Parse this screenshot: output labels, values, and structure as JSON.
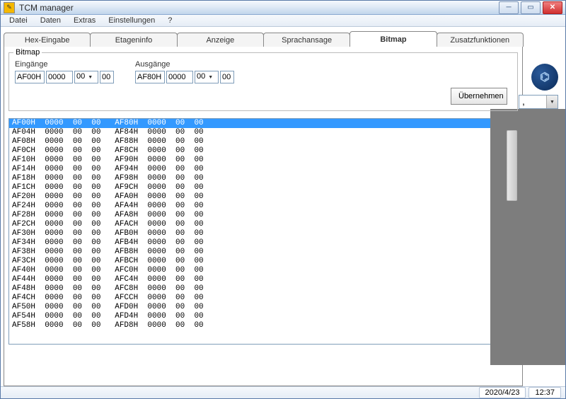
{
  "window": {
    "title": "TCM manager"
  },
  "menu": {
    "items": [
      "Datei",
      "Daten",
      "Extras",
      "Einstellungen",
      "?"
    ]
  },
  "tabs": {
    "items": [
      "Hex-Eingabe",
      "Etageninfo",
      "Anzeige",
      "Sprachansage",
      "Bitmap",
      "Zusatzfunktionen"
    ],
    "active": 4
  },
  "sidebar_dropdown": {
    "value": ","
  },
  "bitmap_group": {
    "legend": "Bitmap",
    "inputs_label": "Eingänge",
    "outputs_label": "Ausgänge",
    "apply_label": "Übernehmen",
    "in": {
      "addr": "AF00H",
      "word": "0000",
      "sel": "00",
      "byte": "00"
    },
    "out": {
      "addr": "AF80H",
      "word": "0000",
      "sel": "00",
      "byte": "00"
    }
  },
  "data_list": {
    "selected": 0,
    "rows": [
      [
        "AF00H",
        "0000",
        "00",
        "00",
        "AF80H",
        "0000",
        "00",
        "00"
      ],
      [
        "AF04H",
        "0000",
        "00",
        "00",
        "AF84H",
        "0000",
        "00",
        "00"
      ],
      [
        "AF08H",
        "0000",
        "00",
        "00",
        "AF88H",
        "0000",
        "00",
        "00"
      ],
      [
        "AF0CH",
        "0000",
        "00",
        "00",
        "AF8CH",
        "0000",
        "00",
        "00"
      ],
      [
        "AF10H",
        "0000",
        "00",
        "00",
        "AF90H",
        "0000",
        "00",
        "00"
      ],
      [
        "AF14H",
        "0000",
        "00",
        "00",
        "AF94H",
        "0000",
        "00",
        "00"
      ],
      [
        "AF18H",
        "0000",
        "00",
        "00",
        "AF98H",
        "0000",
        "00",
        "00"
      ],
      [
        "AF1CH",
        "0000",
        "00",
        "00",
        "AF9CH",
        "0000",
        "00",
        "00"
      ],
      [
        "AF20H",
        "0000",
        "00",
        "00",
        "AFA0H",
        "0000",
        "00",
        "00"
      ],
      [
        "AF24H",
        "0000",
        "00",
        "00",
        "AFA4H",
        "0000",
        "00",
        "00"
      ],
      [
        "AF28H",
        "0000",
        "00",
        "00",
        "AFA8H",
        "0000",
        "00",
        "00"
      ],
      [
        "AF2CH",
        "0000",
        "00",
        "00",
        "AFACH",
        "0000",
        "00",
        "00"
      ],
      [
        "AF30H",
        "0000",
        "00",
        "00",
        "AFB0H",
        "0000",
        "00",
        "00"
      ],
      [
        "AF34H",
        "0000",
        "00",
        "00",
        "AFB4H",
        "0000",
        "00",
        "00"
      ],
      [
        "AF38H",
        "0000",
        "00",
        "00",
        "AFB8H",
        "0000",
        "00",
        "00"
      ],
      [
        "AF3CH",
        "0000",
        "00",
        "00",
        "AFBCH",
        "0000",
        "00",
        "00"
      ],
      [
        "AF40H",
        "0000",
        "00",
        "00",
        "AFC0H",
        "0000",
        "00",
        "00"
      ],
      [
        "AF44H",
        "0000",
        "00",
        "00",
        "AFC4H",
        "0000",
        "00",
        "00"
      ],
      [
        "AF48H",
        "0000",
        "00",
        "00",
        "AFC8H",
        "0000",
        "00",
        "00"
      ],
      [
        "AF4CH",
        "0000",
        "00",
        "00",
        "AFCCH",
        "0000",
        "00",
        "00"
      ],
      [
        "AF50H",
        "0000",
        "00",
        "00",
        "AFD0H",
        "0000",
        "00",
        "00"
      ],
      [
        "AF54H",
        "0000",
        "00",
        "00",
        "AFD4H",
        "0000",
        "00",
        "00"
      ],
      [
        "AF58H",
        "0000",
        "00",
        "00",
        "AFD8H",
        "0000",
        "00",
        "00"
      ]
    ]
  },
  "status": {
    "date": "2020/4/23",
    "time": "12:37"
  }
}
